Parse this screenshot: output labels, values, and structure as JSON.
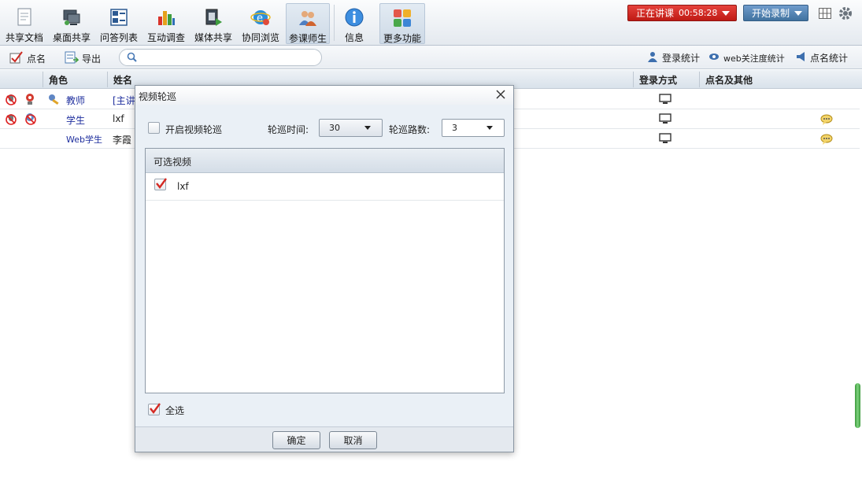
{
  "toolbar": {
    "items": [
      {
        "label": "共享文档",
        "icon": "document-icon"
      },
      {
        "label": "桌面共享",
        "icon": "desktop-share-icon"
      },
      {
        "label": "问答列表",
        "icon": "qa-list-icon"
      },
      {
        "label": "互动调查",
        "icon": "bar-chart-icon"
      },
      {
        "label": "媒体共享",
        "icon": "media-share-icon"
      },
      {
        "label": "协同浏览",
        "icon": "browser-icon"
      },
      {
        "label": "参课师生",
        "icon": "users-icon"
      },
      {
        "label": "信息",
        "icon": "info-icon"
      },
      {
        "label": "更多功能",
        "icon": "grid-apps-icon"
      }
    ],
    "live_label": "正在讲课",
    "live_timer": "00:58:28",
    "record_label": "开始录制",
    "colors": {
      "live": "#d42a24",
      "record": "#5686b8"
    }
  },
  "subbar": {
    "rollcall_label": "点名",
    "export_label": "导出",
    "search_placeholder": "",
    "login_stats": "登录统计",
    "web_attention": "web关注度统计",
    "rollcall_stats": "点名统计"
  },
  "table": {
    "headers": {
      "role": "角色",
      "name": "姓名",
      "login": "登录方式",
      "rollcall": "点名及其他"
    },
    "rows": [
      {
        "role": "教师",
        "name": "[主讲"
      },
      {
        "role": "学生",
        "name": "lxf"
      },
      {
        "role": "Web学生",
        "name": "李霞"
      }
    ]
  },
  "dialog": {
    "title": "视频轮巡",
    "enable_label": "开启视频轮巡",
    "interval_label": "轮巡时间:",
    "interval_value": "30",
    "count_label": "轮巡路数:",
    "count_value": "3",
    "list_header": "可选视频",
    "videos": [
      {
        "name": "lxf",
        "checked": true
      }
    ],
    "select_all": "全选",
    "ok": "确定",
    "cancel": "取消"
  }
}
